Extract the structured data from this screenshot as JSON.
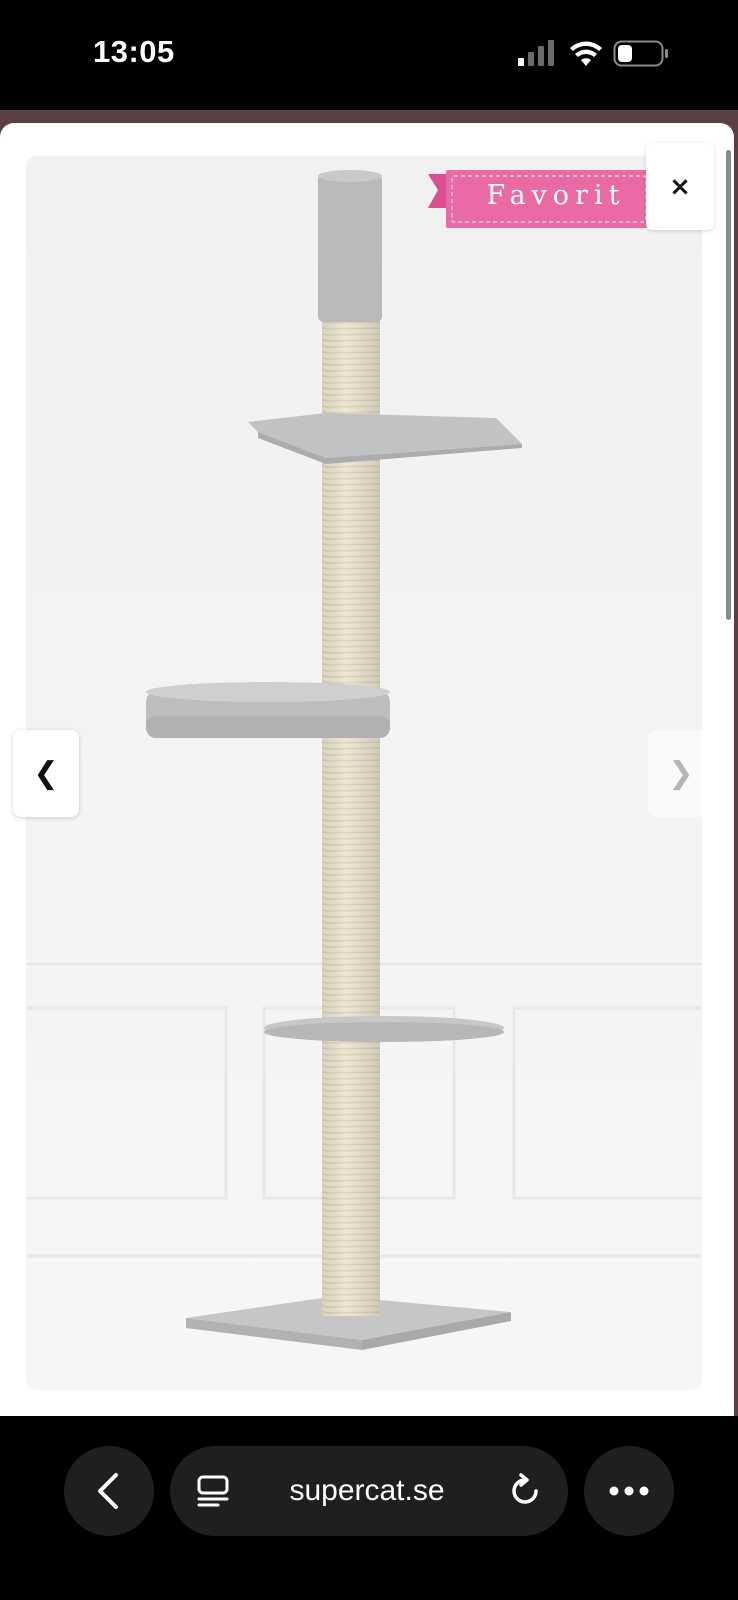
{
  "status_bar": {
    "time": "13:05",
    "icons": [
      "cellular-signal-icon",
      "wifi-icon",
      "battery-icon"
    ]
  },
  "modal": {
    "badge_label": "Favorit",
    "close_glyph": "×",
    "prev_glyph": "❮",
    "next_glyph": "❯",
    "image_subject": "Floor-to-ceiling cat tree with sisal posts and grey platforms"
  },
  "toolbar": {
    "url": "supercat.se",
    "icons": [
      "back-chevron-icon",
      "tabs-icon",
      "reload-icon",
      "more-icon"
    ]
  },
  "colors": {
    "badge_pink": "#e96aa4",
    "platform_grey": "#bdbdbf",
    "sisal": "#ece3cf",
    "toolbar_bg": "#1f1f1f"
  }
}
